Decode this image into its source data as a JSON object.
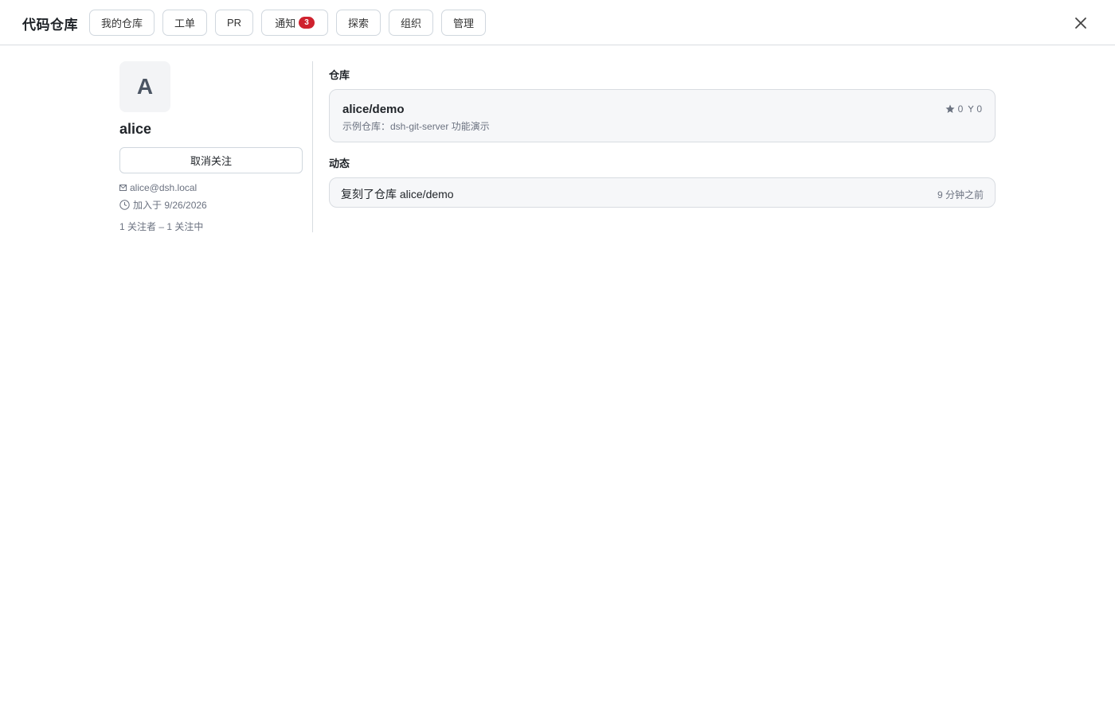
{
  "header": {
    "brand": "代码仓库",
    "nav": [
      {
        "label": "我的仓库"
      },
      {
        "label": "工单"
      },
      {
        "label": "PR"
      },
      {
        "label": "通知",
        "badge": "3"
      },
      {
        "label": "探索"
      },
      {
        "label": "组织"
      },
      {
        "label": "管理"
      }
    ],
    "close_icon": "close-icon"
  },
  "profile": {
    "avatar_letter": "A",
    "username": "alice",
    "follow_button": "取消关注",
    "email": "alice@dsh.local",
    "joined": "加入于 9/26/2026",
    "follow_stats": "1 关注者 – 1 关注中"
  },
  "repos": {
    "title": "仓库",
    "items": [
      {
        "name": "alice/demo",
        "description": "示例仓库：dsh-git-server 功能演示",
        "stars": "0",
        "forks": "0"
      }
    ]
  },
  "activity": {
    "title": "动态",
    "items": [
      {
        "text": "复刻了仓库 alice/demo",
        "time": "9 分钟之前"
      }
    ]
  },
  "colors": {
    "badge": "#cf222e",
    "border": "#d8dce1",
    "card_bg": "#f6f7f9",
    "muted_text": "#6b7280"
  }
}
